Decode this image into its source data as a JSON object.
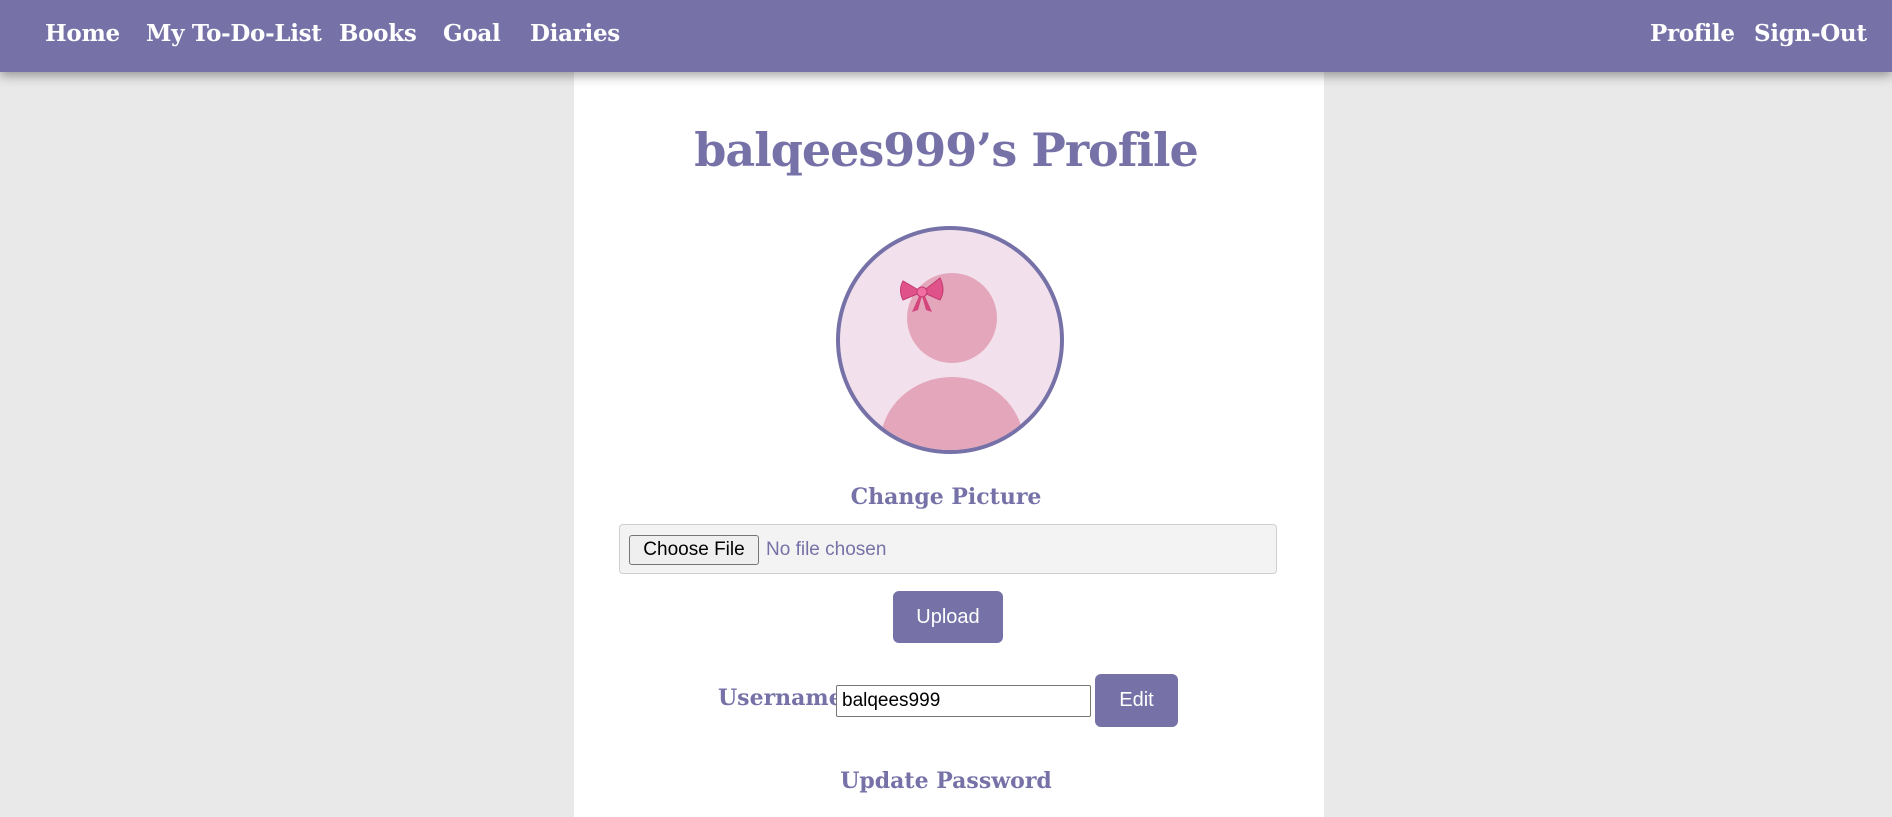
{
  "nav": {
    "left_items": [
      "Home",
      "My To-Do-List",
      "Books",
      "Goal",
      "Diaries"
    ],
    "right_items": [
      "Profile",
      "Sign-Out"
    ]
  },
  "profile": {
    "title": "balqees999’s Profile",
    "avatar_icon": "girl-with-bow-avatar-icon",
    "change_picture_label": "Change Picture",
    "choose_file_label": "Choose File",
    "file_status": "No file chosen",
    "upload_label": "Upload",
    "username_label": "Username",
    "username_value": "balqees999",
    "edit_label": "Edit",
    "update_password_label": "Update Password"
  },
  "colors": {
    "accent": "#7672a8",
    "background": "#e9e9e9",
    "avatar_bg": "#f2e1ec",
    "avatar_figure": "#e4a6ba",
    "bow": "#e0528a"
  }
}
